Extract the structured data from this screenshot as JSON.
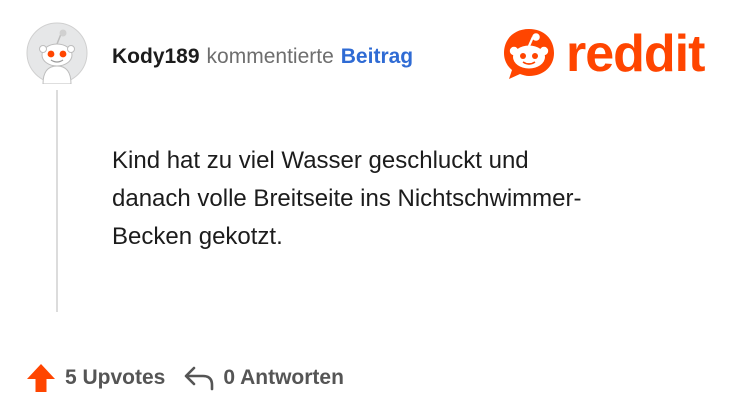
{
  "comment": {
    "username": "Kody189",
    "action": "kommentierte",
    "target_link": "Beitrag",
    "body_lines": [
      "Kind hat zu viel Wasser geschluckt und",
      "danach volle Breitseite ins Nichtschwimmer-",
      "Becken gekotzt."
    ]
  },
  "brand": {
    "wordmark": "reddit",
    "color": "#ff4500",
    "icon": "reddit-snoo-icon"
  },
  "footer": {
    "upvotes_label": "5 Upvotes",
    "upvote_icon": "upvote-arrow-icon",
    "replies_label": "0 Antworten",
    "reply_icon": "reply-arrow-icon"
  },
  "avatar": {
    "icon": "default-snoo-avatar-icon"
  }
}
